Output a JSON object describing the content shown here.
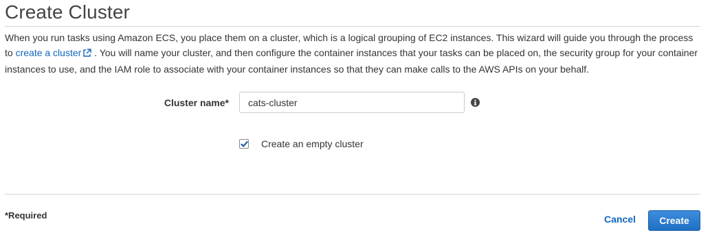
{
  "page": {
    "title": "Create Cluster"
  },
  "description": {
    "text_before_link": "When you run tasks using Amazon ECS, you place them on a cluster, which is a logical grouping of EC2 instances. This wizard will guide you through the process to ",
    "link_text": "create a cluster",
    "link_icon": "external-link-icon",
    "text_after_link": " . You will name your cluster, and then configure the container instances that your tasks can be placed on, the security group for your container instances to use, and the IAM role to associate with your container instances so that they can make calls to the AWS APIs on your behalf."
  },
  "form": {
    "cluster_name_label": "Cluster name*",
    "cluster_name_value": "cats-cluster",
    "info_icon": "info-icon",
    "empty_cluster_label": "Create an empty cluster",
    "empty_cluster_checked": true
  },
  "footer": {
    "required_note": "*Required",
    "cancel_label": "Cancel",
    "create_label": "Create"
  },
  "colors": {
    "link": "#1166bb",
    "primary_button": "#1f6fc4",
    "checkbox_check": "#1a5da6"
  }
}
